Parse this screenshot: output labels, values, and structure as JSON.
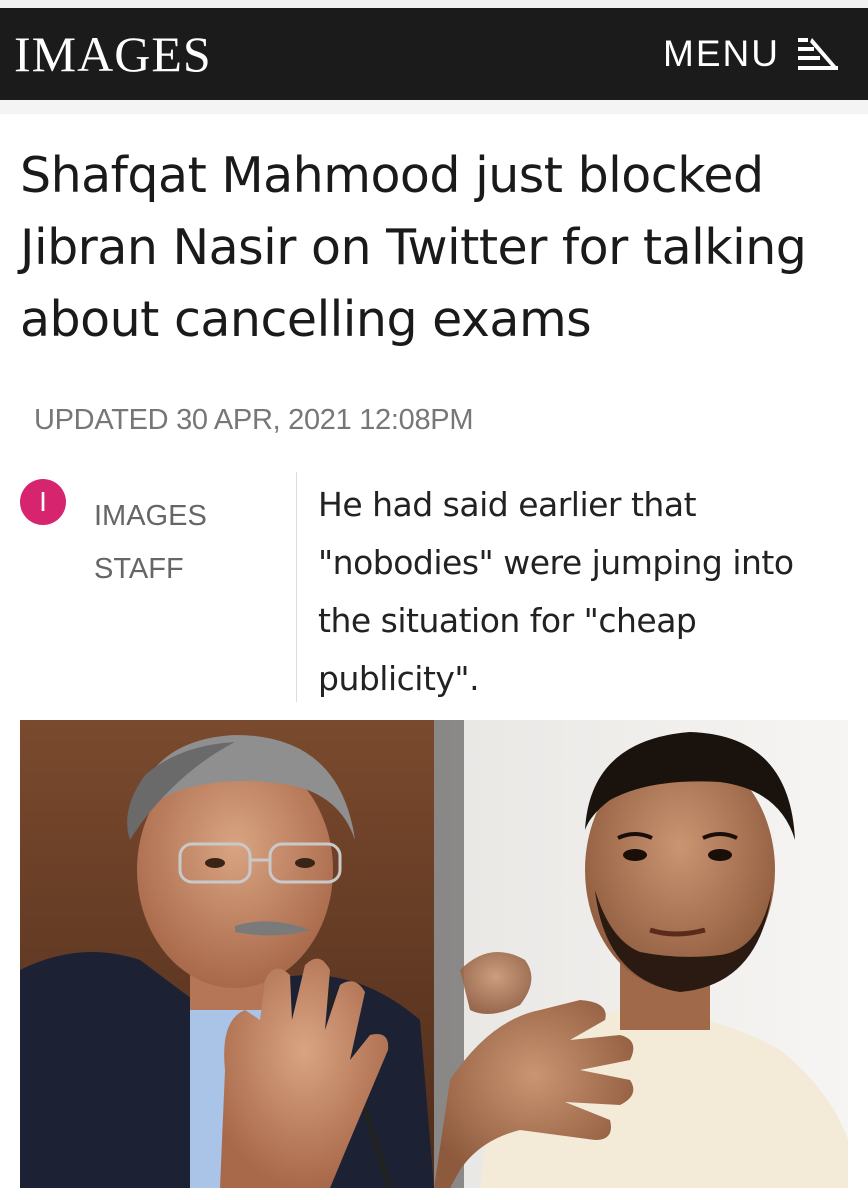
{
  "header": {
    "logo_text": "IMAGES",
    "menu_label": "MENU",
    "menu_icon": "menu-icon",
    "background": "#1b1b1b"
  },
  "article": {
    "headline": "Shafqat Mahmood just blocked Jibran Nasir on Twitter for talking about cancelling exams",
    "updated": "UPDATED 30 APR, 2021 12:08PM",
    "author": {
      "avatar_letter": "I",
      "avatar_color": "#d6246f",
      "name": "IMAGES STAFF"
    },
    "excerpt": "He had said earlier that \"nobodies\" were jumping into the situation for \"cheap publicity\".",
    "photo": {
      "description_icon": "article-photo"
    }
  }
}
